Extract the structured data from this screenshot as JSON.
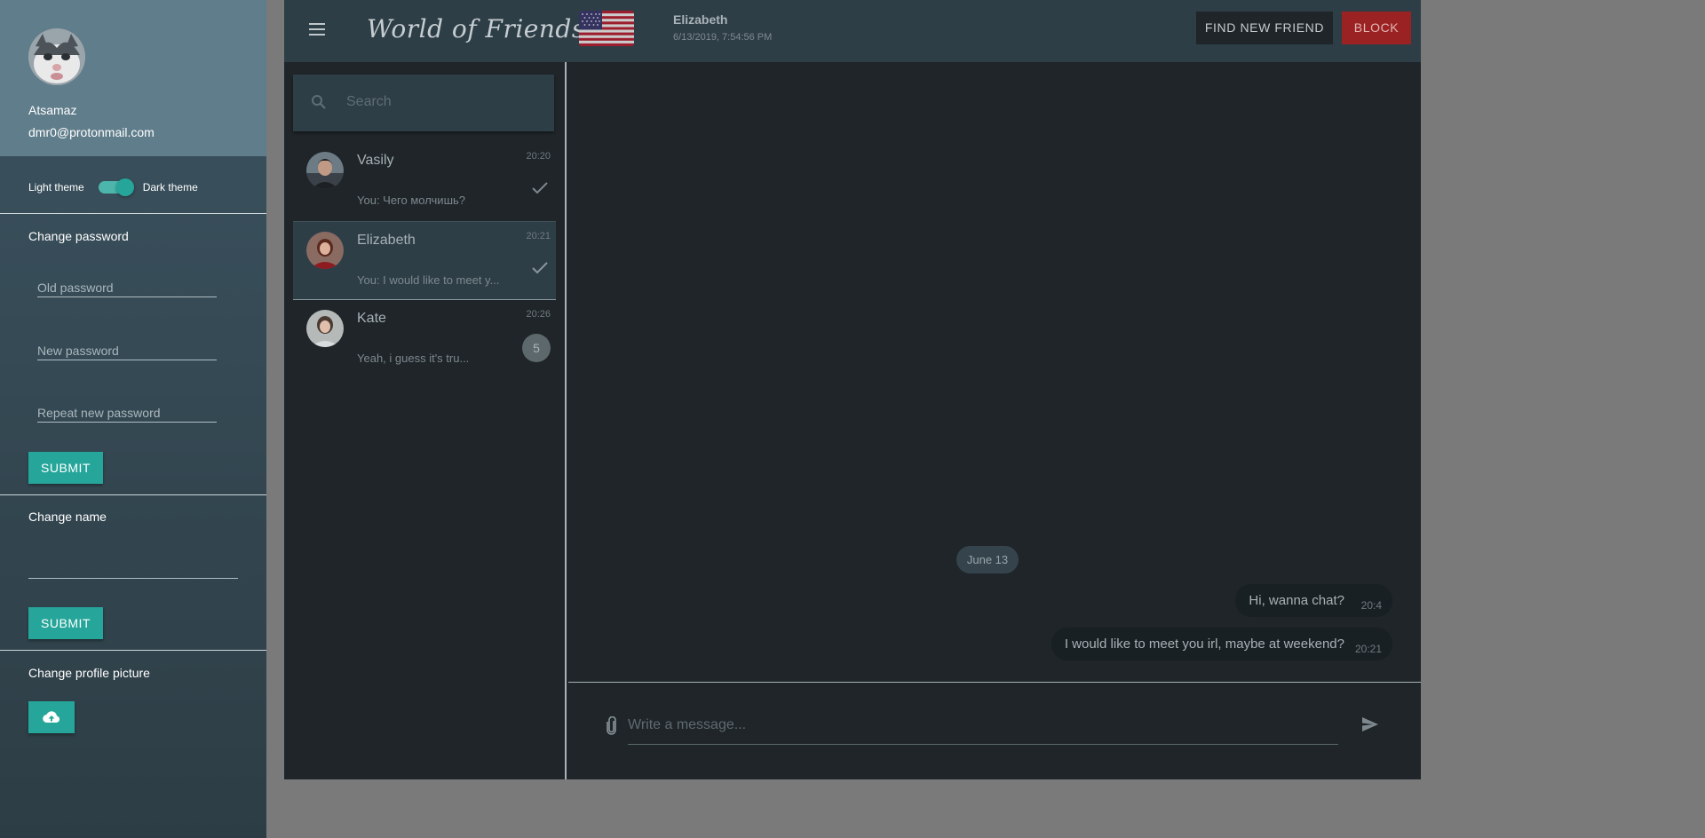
{
  "profile": {
    "name": "Atsamaz",
    "email": "dmr0@protonmail.com",
    "avatar_icon": "cat-avatar"
  },
  "theme": {
    "light_label": "Light theme",
    "dark_label": "Dark theme",
    "dark_enabled": true
  },
  "change_password": {
    "title": "Change password",
    "old_placeholder": "Old password",
    "new_placeholder": "New password",
    "repeat_placeholder": "Repeat new password",
    "submit_label": "SUBMIT"
  },
  "change_name": {
    "title": "Change name",
    "value": "",
    "submit_label": "SUBMIT"
  },
  "change_picture": {
    "title": "Change profile picture",
    "upload_icon": "cloud-upload-icon"
  },
  "header": {
    "app_title": "World of Friends",
    "chat_partner": "Elizabeth",
    "last_seen": "6/13/2019, 7:54:56 PM",
    "flag_icon": "us-flag",
    "find_friend_label": "FIND NEW FRIEND",
    "block_label": "BLOCK"
  },
  "search": {
    "placeholder": "Search"
  },
  "contacts": [
    {
      "name": "Vasily",
      "time": "20:20",
      "preview": "You: Чего молчишь?",
      "status": "read",
      "active": false
    },
    {
      "name": "Elizabeth",
      "time": "20:21",
      "preview": "You: I would like to meet y...",
      "status": "read",
      "active": true
    },
    {
      "name": "Kate",
      "time": "20:26",
      "preview": "Yeah, i guess it's tru...",
      "unread": "5",
      "active": false
    }
  ],
  "chat": {
    "date_divider": "June 13",
    "messages": [
      {
        "text": "Hi, wanna chat?",
        "time": "20:4",
        "outgoing": true
      },
      {
        "text": "I would like to meet you irl, maybe at weekend?",
        "time": "20:21",
        "outgoing": true
      }
    ],
    "input_placeholder": "Write a message..."
  },
  "colors": {
    "accent": "#26a69a",
    "block": "#9b2222",
    "header_bg": "#2e3e46",
    "chat_bg": "#1f2529"
  }
}
